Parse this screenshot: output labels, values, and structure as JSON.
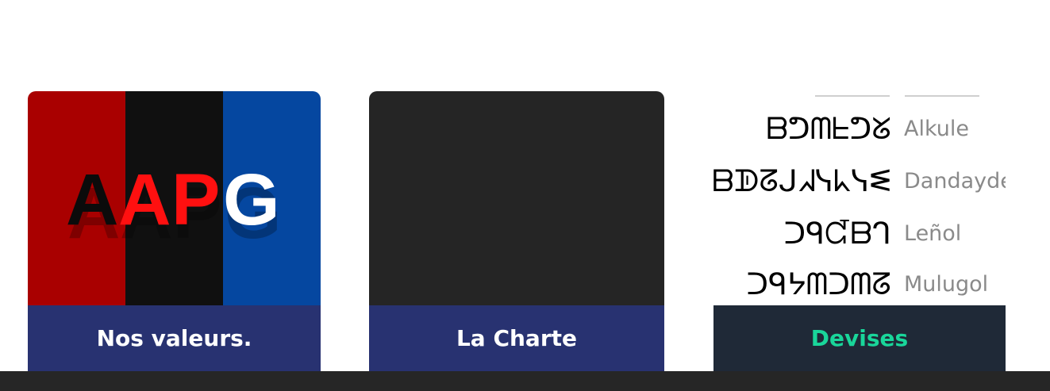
{
  "cards": [
    {
      "caption": "Nos valeurs.",
      "logo_text": "AAPG",
      "logo_letters": [
        "A",
        "A",
        "P",
        "G"
      ],
      "stripe_colors": [
        "#a90000",
        "#101010",
        "#0547a0"
      ]
    },
    {
      "caption": "La Charte"
    },
    {
      "caption": "Devises",
      "caption_color": "#19d69a",
      "scripts": [
        {
          "glyphs": "ᗷᕤᗰᖶᕤᘜ",
          "label": "Alkule"
        },
        {
          "glyphs": "ᗷᗫᘔᒍᖽᓭᖾᓭᓬ",
          "label": "Dandayde"
        },
        {
          "glyphs": "ᑐᑫᘹᗷᒉ",
          "label": "Leñol"
        },
        {
          "glyphs": "ᑐᑫᔭᗰᑐᗰᘔ",
          "label": "Mulugol"
        }
      ]
    }
  ]
}
